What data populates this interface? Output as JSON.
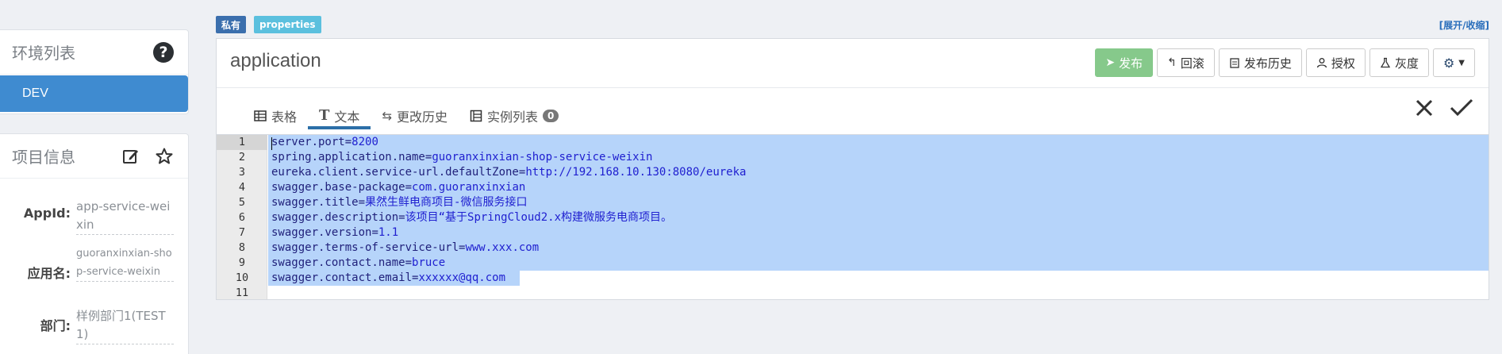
{
  "sidebar": {
    "env_title": "环境列表",
    "env_items": [
      {
        "label": "DEV"
      }
    ],
    "project_title": "项目信息",
    "project_info": [
      {
        "label": "AppId:",
        "value": "app-service-weixin"
      },
      {
        "label": "应用名:",
        "value": "guoranxinxian-shop-service-weixin"
      },
      {
        "label": "部门:",
        "value": "样例部门1(TEST1)"
      }
    ]
  },
  "tags": {
    "private": "私有",
    "format": "properties"
  },
  "toggle": "[展开/收缩]",
  "namespace": {
    "title": "application"
  },
  "buttons": {
    "publish": "发布",
    "rollback": "回滚",
    "history": "发布历史",
    "auth": "授权",
    "gray": "灰度"
  },
  "tabs": [
    {
      "label": "表格"
    },
    {
      "label": "文本"
    },
    {
      "label": "更改历史"
    },
    {
      "label": "实例列表",
      "badge": "0"
    }
  ],
  "editor": {
    "lines": [
      {
        "n": "1",
        "key": "server.port",
        "val": "8200"
      },
      {
        "n": "2",
        "key": "spring.application.name",
        "val": "guoranxinxian-shop-service-weixin"
      },
      {
        "n": "3",
        "key": "eureka.client.service-url.defaultZone",
        "val": "http://192.168.10.130:8080/eureka"
      },
      {
        "n": "4",
        "key": "swagger.base-package",
        "val": "com.guoranxinxian"
      },
      {
        "n": "5",
        "key": "swagger.title",
        "val": "果然生鲜电商项目-微信服务接口"
      },
      {
        "n": "6",
        "key": "swagger.description",
        "val": "该项目“基于SpringCloud2.x构建微服务电商项目。"
      },
      {
        "n": "7",
        "key": "swagger.version",
        "val": "1.1"
      },
      {
        "n": "8",
        "key": "swagger.terms-of-service-url",
        "val": "www.xxx.com"
      },
      {
        "n": "9",
        "key": "swagger.contact.name",
        "val": "bruce"
      },
      {
        "n": "10",
        "key": "swagger.contact.email",
        "val": "xxxxxx@qq.com"
      },
      {
        "n": "11",
        "key": "",
        "val": ""
      }
    ]
  },
  "colors": {
    "accent": "#3f8bd0",
    "publish": "#86c98b",
    "selection": "#b6d4fa"
  }
}
